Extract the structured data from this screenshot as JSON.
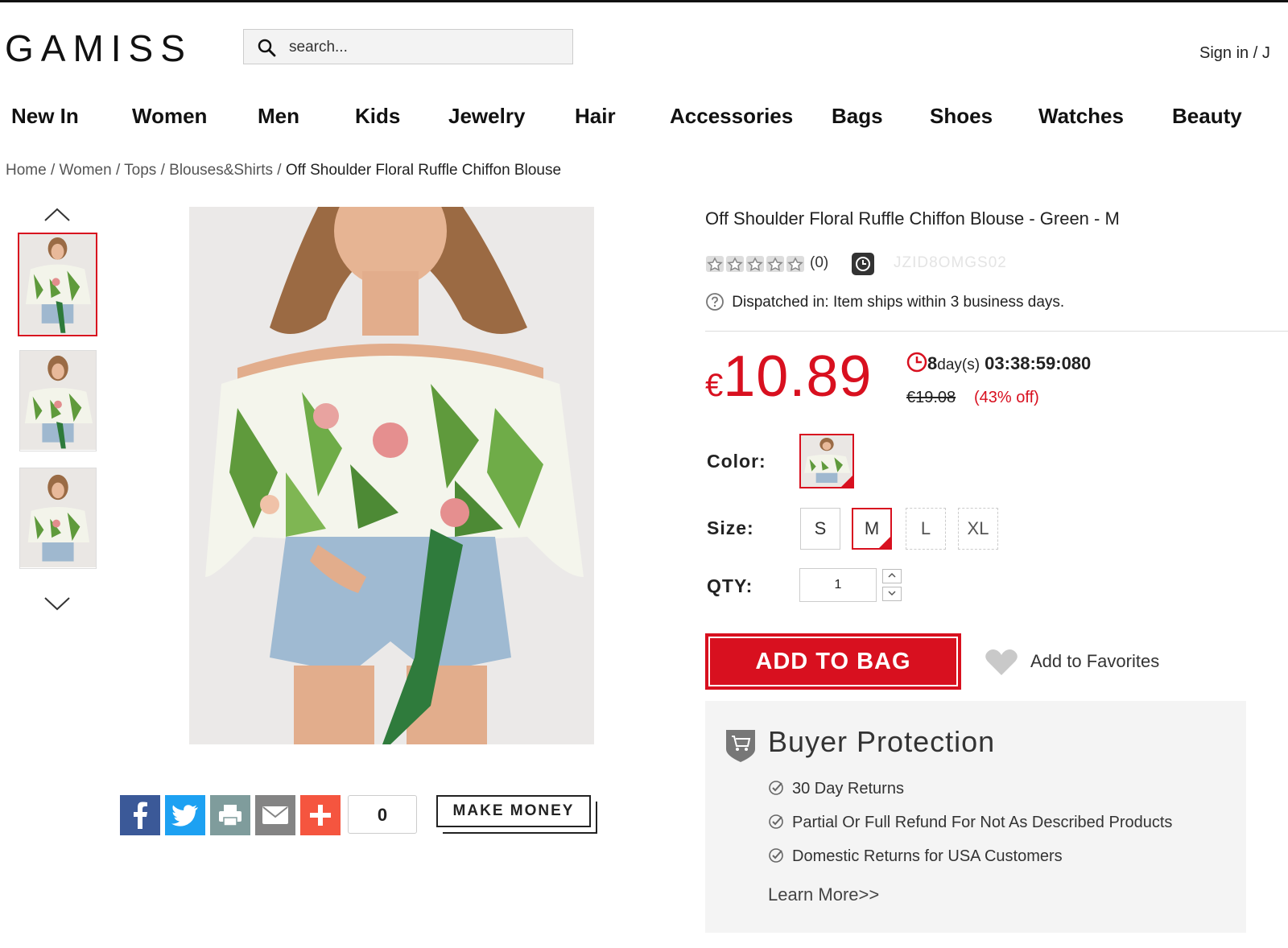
{
  "header": {
    "logo": "GAMISS",
    "search_placeholder": "search...",
    "signin": "Sign in / J"
  },
  "nav": [
    "New In",
    "Women",
    "Men",
    "Kids",
    "Jewelry",
    "Hair",
    "Accessories",
    "Bags",
    "Shoes",
    "Watches",
    "Beauty"
  ],
  "breadcrumb": {
    "items": [
      "Home",
      "Women",
      "Tops",
      "Blouses&Shirts"
    ],
    "separator": "/",
    "current": "Off Shoulder Floral Ruffle Chiffon Blouse"
  },
  "product": {
    "title": "Off Shoulder Floral Ruffle Chiffon Blouse - Green - M",
    "rating_stars": 0,
    "rating_count": "(0)",
    "sku": "JZID8OMGS02",
    "dispatch_label": "Dispatched in:",
    "dispatch_text": "Item ships within 3 business days.",
    "currency": "€",
    "price": "10.89",
    "countdown_days": "8",
    "countdown_days_suffix": "day(s)",
    "countdown_time": "03:38:59:080",
    "old_price": "€19.08",
    "discount": "(43% off)",
    "color_label": "Color:",
    "size_label": "Size:",
    "qty_label": "QTY:",
    "sizes": [
      "S",
      "M",
      "L",
      "XL"
    ],
    "selected_size": "M",
    "qty_value": "1",
    "add_to_bag": "ADD TO BAG",
    "add_to_favorites": "Add to Favorites"
  },
  "share": {
    "count": "0",
    "make_money": "MAKE MONEY"
  },
  "protection": {
    "title": "Buyer Protection",
    "items": [
      "30 Day Returns",
      "Partial Or Full Refund For Not As Described Products",
      "Domestic Returns for USA Customers"
    ],
    "learn_more": "Learn More>>"
  },
  "colors": {
    "accent": "#d8101f",
    "facebook": "#3b5998",
    "twitter": "#1da1f2",
    "print": "#7f9c9c",
    "email": "#848484",
    "plus": "#f5553f"
  },
  "icons": [
    "search-icon",
    "chevron-up-icon",
    "chevron-down-icon",
    "star-icon",
    "clock-icon",
    "question-icon",
    "heart-icon",
    "shield-cart-icon",
    "check-circle-icon",
    "facebook-icon",
    "twitter-icon",
    "print-icon",
    "email-icon",
    "plus-icon"
  ]
}
